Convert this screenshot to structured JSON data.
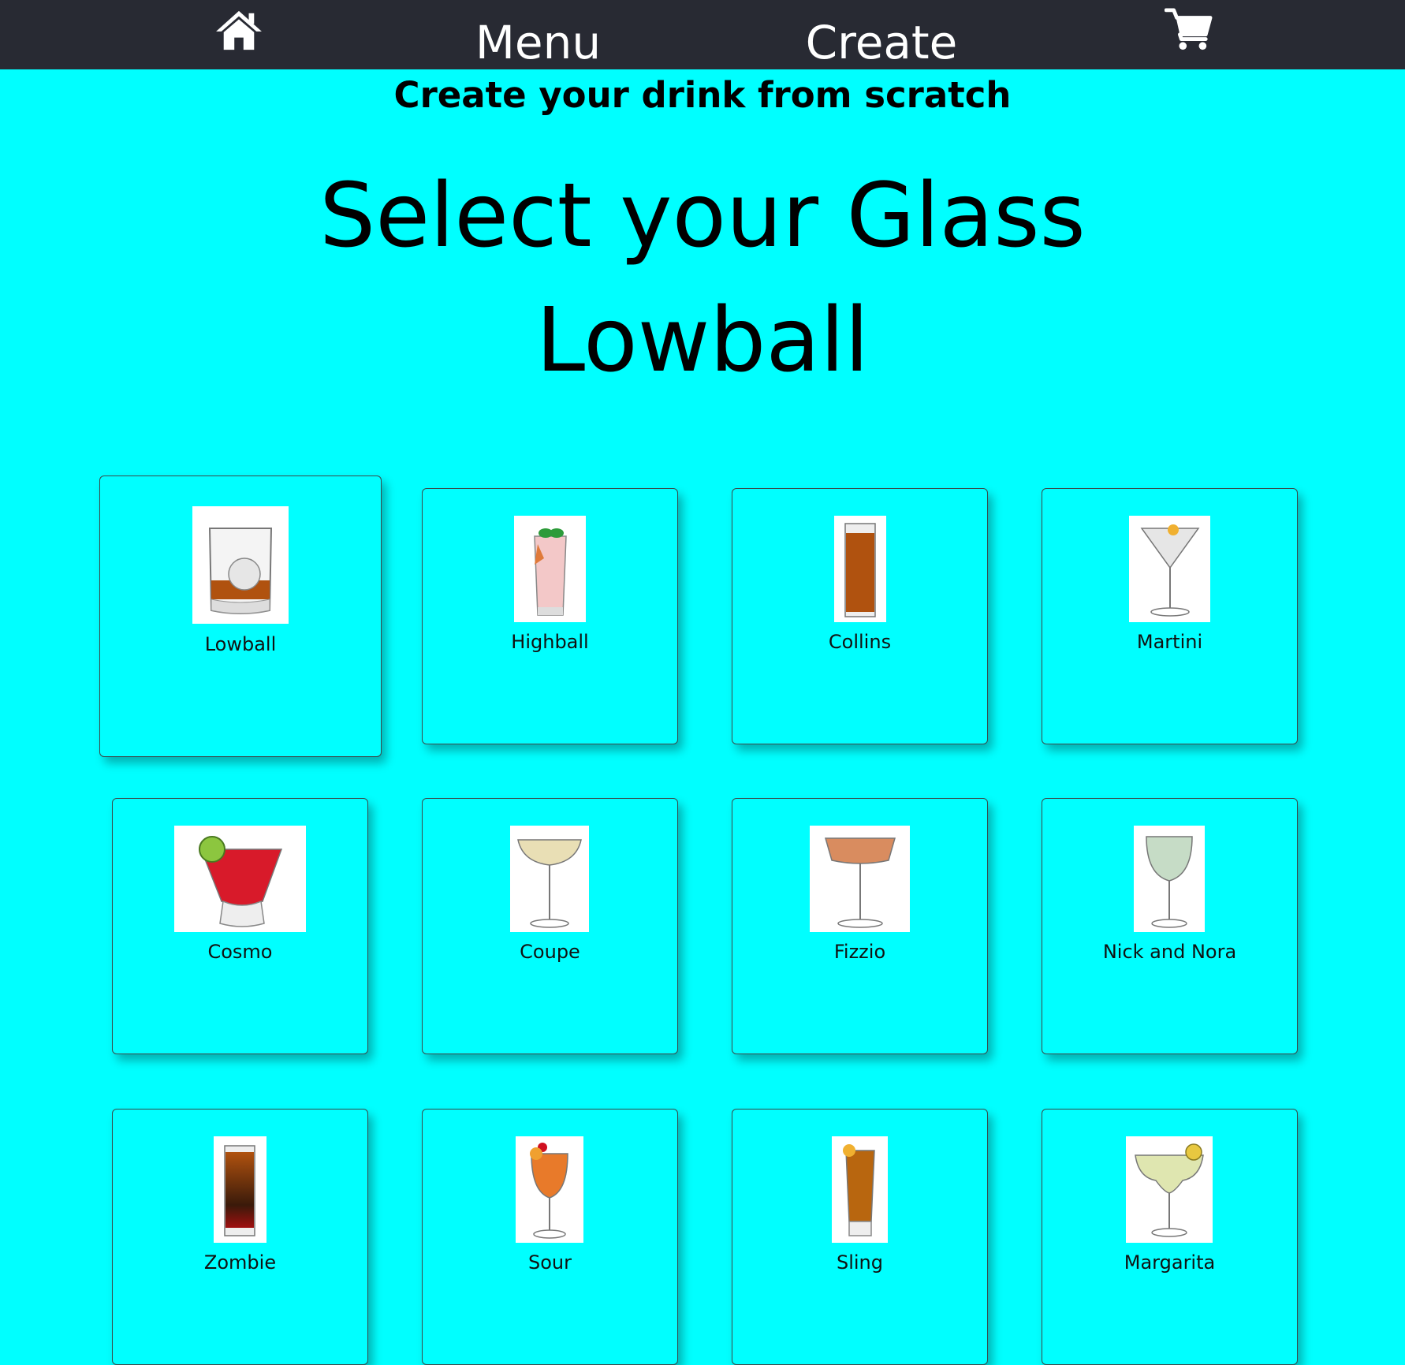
{
  "nav": {
    "home_icon": "home-icon",
    "menu_label": "Menu",
    "create_label": "Create",
    "cart_icon": "shopping-cart-icon"
  },
  "page": {
    "subtitle": "Create your drink from scratch",
    "heading": "Select your Glass",
    "selected_glass": "Lowball"
  },
  "glasses": [
    {
      "name": "Lowball",
      "icon": "lowball-glass-icon",
      "selected": true
    },
    {
      "name": "Highball",
      "icon": "highball-glass-icon"
    },
    {
      "name": "Collins",
      "icon": "collins-glass-icon"
    },
    {
      "name": "Martini",
      "icon": "martini-glass-icon"
    },
    {
      "name": "Cosmo",
      "icon": "cosmo-glass-icon"
    },
    {
      "name": "Coupe",
      "icon": "coupe-glass-icon"
    },
    {
      "name": "Fizzio",
      "icon": "fizzio-glass-icon"
    },
    {
      "name": "Nick and Nora",
      "icon": "nick-and-nora-glass-icon"
    },
    {
      "name": "Zombie",
      "icon": "zombie-glass-icon"
    },
    {
      "name": "Sour",
      "icon": "sour-glass-icon"
    },
    {
      "name": "Sling",
      "icon": "sling-glass-icon"
    },
    {
      "name": "Margarita",
      "icon": "margarita-glass-icon"
    }
  ],
  "colors": {
    "background": "#00FFFF",
    "navbar": "#282A33",
    "nav_text": "#FFFFFF"
  }
}
